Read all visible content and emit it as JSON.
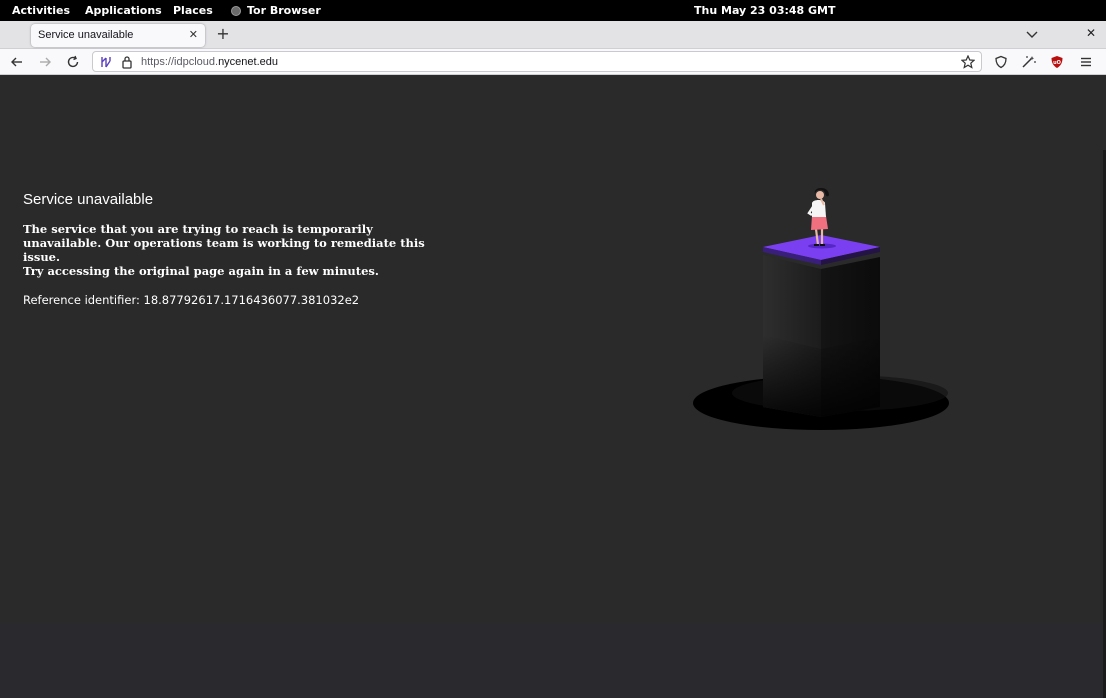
{
  "topbar": {
    "activities": "Activities",
    "applications": "Applications",
    "places": "Places",
    "app_name": "Tor Browser",
    "clock": "Thu May 23  03:48 GMT"
  },
  "tabs": [
    {
      "title": "Service unavailable",
      "active": true
    }
  ],
  "urlbar": {
    "scheme_prefix": "https://idpcloud.",
    "host": "nycenet.edu"
  },
  "page": {
    "title": "Service unavailable",
    "description": "The service that you are trying to reach is temporarily unavailable. Our operations team is working to remediate this issue.",
    "retry": "Try accessing the original page again in a few minutes.",
    "reference": "Reference identifier: 18.87792617.1716436077.381032e2"
  },
  "colors": {
    "page_bg": "#2a2a2a",
    "platform_accent": "#7b3ff2",
    "ublock_red": "#b80e0e"
  },
  "icons": {
    "back": "arrow-left-icon",
    "forward": "arrow-right-icon",
    "reload": "reload-icon",
    "tracking": "tor-circuit-icon",
    "lock": "lock-icon",
    "bookmark": "star-icon",
    "shield": "shield-icon",
    "extensions": "magic-wand-icon",
    "ublock": "ublock-origin-icon",
    "menu": "hamburger-menu-icon"
  }
}
